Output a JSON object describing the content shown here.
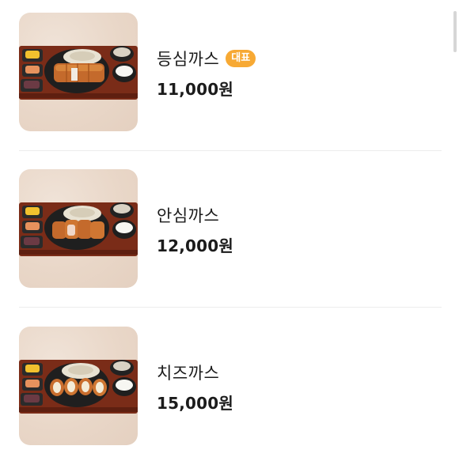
{
  "menu": {
    "items": [
      {
        "name": "등심까스",
        "badge": "대표",
        "price": "11,000원",
        "image": "pork-loin-cutlet-set"
      },
      {
        "name": "안심까스",
        "badge": "",
        "price": "12,000원",
        "image": "pork-tenderloin-cutlet-set"
      },
      {
        "name": "치즈까스",
        "badge": "",
        "price": "15,000원",
        "image": "cheese-cutlet-set"
      }
    ]
  },
  "colors": {
    "badge": "#f7a934",
    "text": "#1b1b1b",
    "divider": "#ececec"
  }
}
